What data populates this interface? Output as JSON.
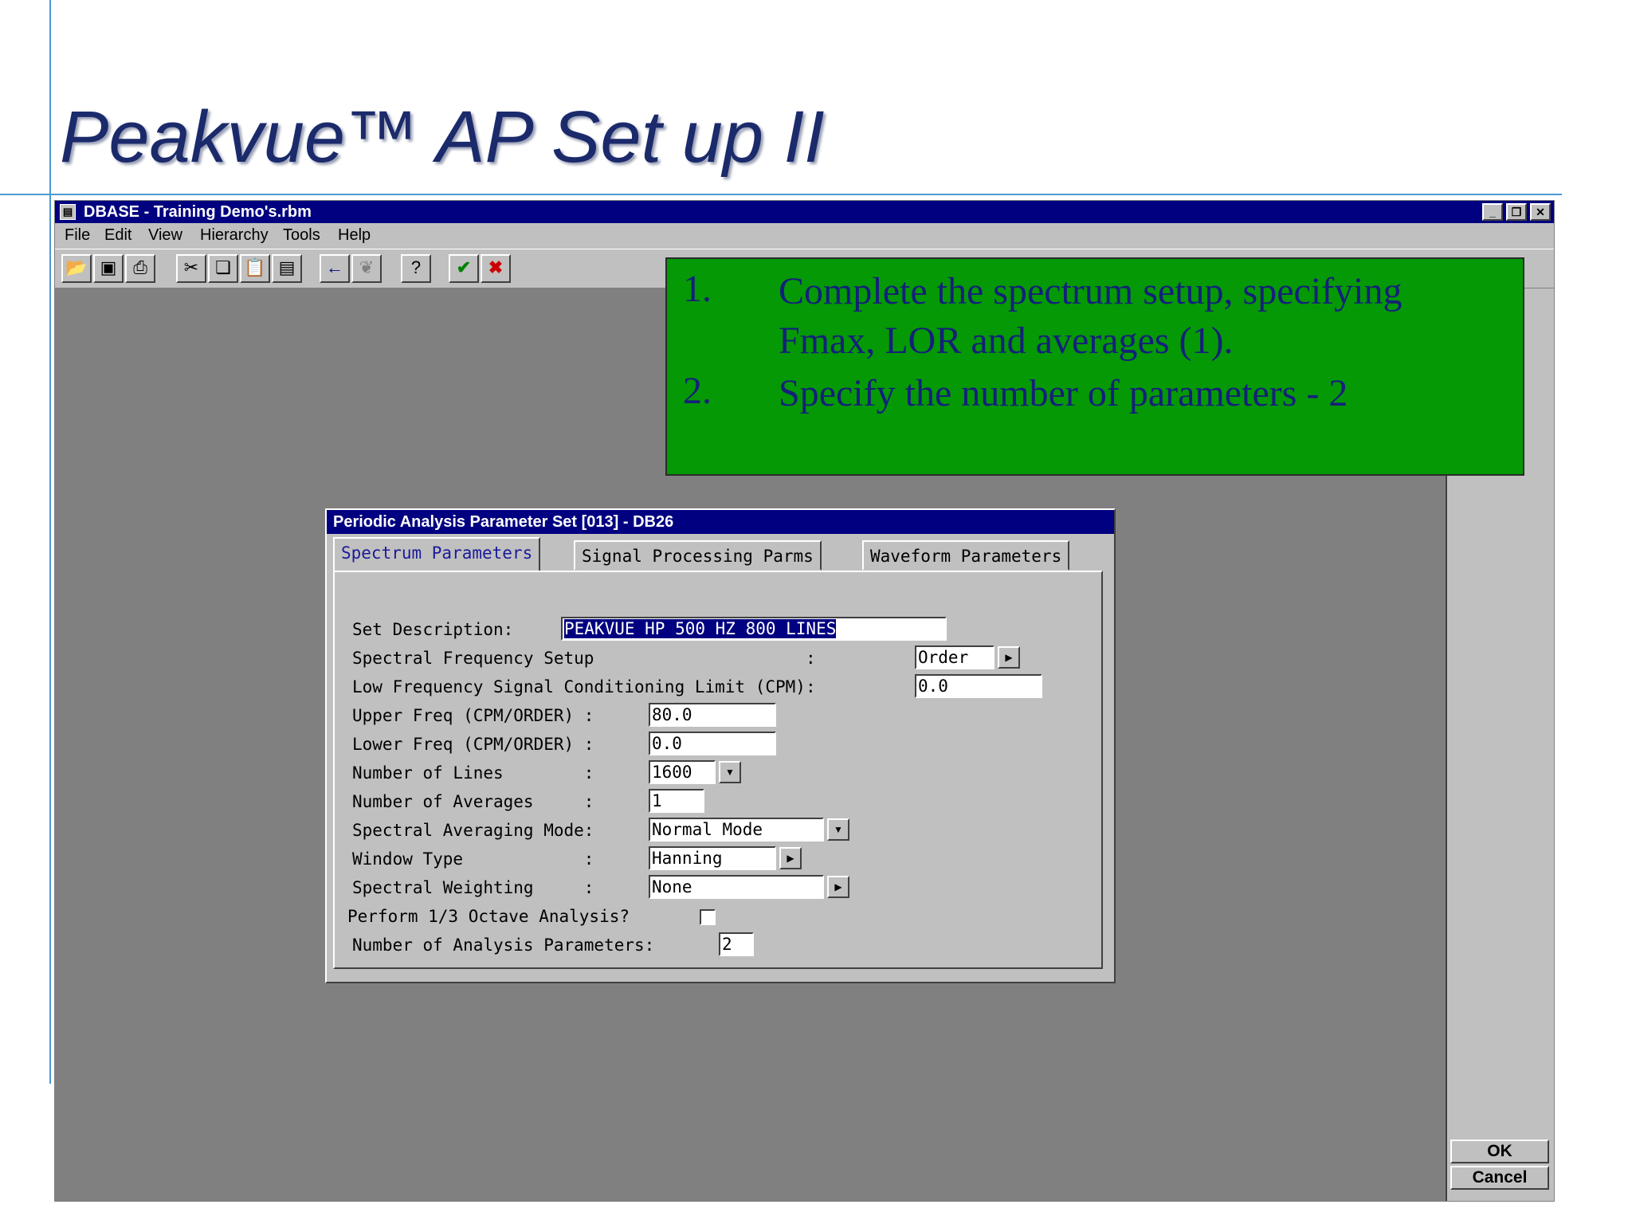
{
  "slide": {
    "title": "Peakvue™ AP Set up II"
  },
  "window": {
    "title": "DBASE - Training Demo's.rbm"
  },
  "menu": [
    "File",
    "Edit",
    "View",
    "Hierarchy",
    "Tools",
    "Help"
  ],
  "toolbar_icons": [
    "open-icon",
    "save-icon",
    "print-icon",
    "cut-icon",
    "copy-icon",
    "paste-icon",
    "document-icon",
    "back-arrow-icon",
    "tree-icon",
    "help-icon",
    "check-icon",
    "cancel-x-icon"
  ],
  "note": {
    "items": [
      {
        "num": "1.",
        "text": "Complete the spectrum setup, specifying Fmax, LOR and averages (1)."
      },
      {
        "num": "2.",
        "text": "Specify the number of parameters - 2"
      }
    ]
  },
  "dialog": {
    "title": "Periodic Analysis Parameter Set [013] - DB26",
    "tabs": [
      "Spectrum Parameters",
      "Signal Processing Parms",
      "Waveform Parameters"
    ],
    "fields": {
      "set_description": {
        "label": "Set Description:",
        "value": "PEAKVUE HP 500 HZ 800 LINES"
      },
      "spectral_frequency_setup": {
        "label": "Spectral Frequency Setup                     :",
        "value": "Order"
      },
      "low_freq_limit": {
        "label": "Low Frequency Signal Conditioning Limit (CPM):",
        "value": "0.0"
      },
      "upper_freq": {
        "label": "Upper Freq (CPM/ORDER) :",
        "value": "80.0"
      },
      "lower_freq": {
        "label": "Lower Freq (CPM/ORDER) :",
        "value": "0.0"
      },
      "number_of_lines": {
        "label": "Number of Lines        :",
        "value": "1600"
      },
      "number_of_averages": {
        "label": "Number of Averages     :",
        "value": "1"
      },
      "averaging_mode": {
        "label": "Spectral Averaging Mode:",
        "value": "Normal Mode"
      },
      "window_type": {
        "label": "Window Type            :",
        "value": "Hanning"
      },
      "spectral_weighting": {
        "label": "Spectral Weighting     :",
        "value": "None"
      },
      "octave_analysis": {
        "label": "Perform 1/3 Octave Analysis?",
        "checked": false
      },
      "num_analysis_params": {
        "label": "Number of Analysis Parameters:",
        "value": "2"
      }
    }
  },
  "buttons": {
    "ok": "OK",
    "cancel": "Cancel"
  }
}
